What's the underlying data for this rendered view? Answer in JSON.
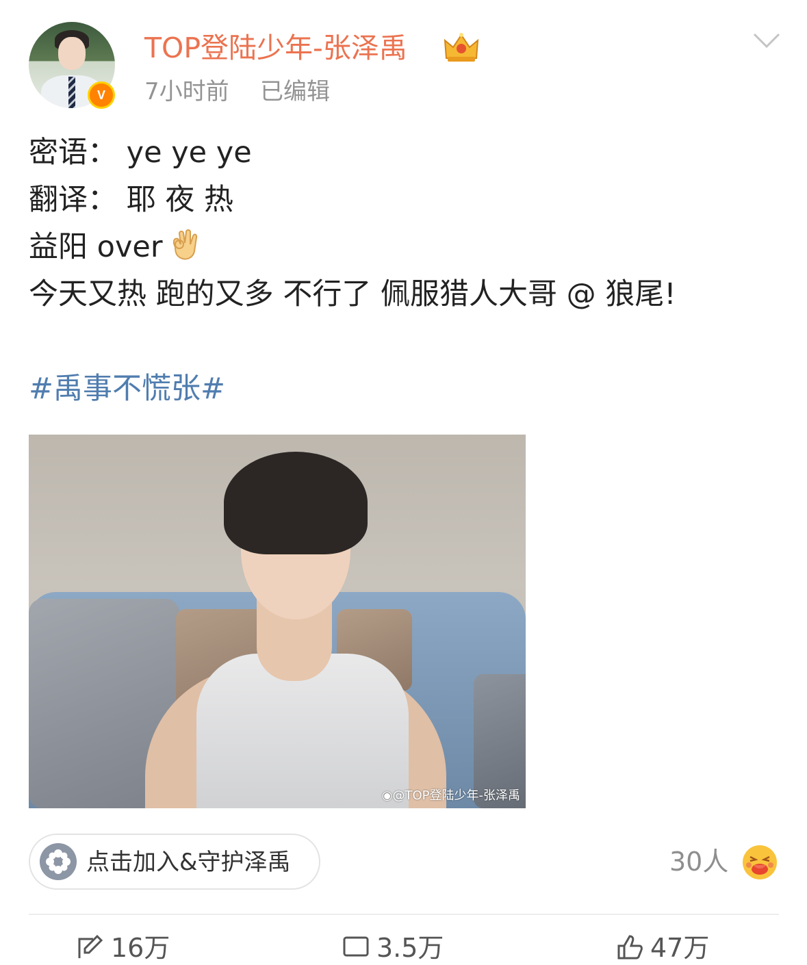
{
  "post": {
    "author": "TOP登陆少年-张泽禹",
    "verified_badge": "V",
    "time": "7小时前",
    "edited": "已编辑",
    "lines": [
      "密语：  ye ye ye",
      "翻译：  耶 夜 热",
      "益阳 over",
      "今天又热 跑的又多 不行了 佩服猎人大哥 @ 狼尾!"
    ],
    "topic": "#禹事不慌张#",
    "image_watermark": "@TOP登陆少年-张泽禹"
  },
  "fan_club": {
    "join_label": "点击加入&守护泽禹",
    "count": "30人"
  },
  "actions": {
    "repost": "16万",
    "comment": "3.5万",
    "like": "47万"
  },
  "colors": {
    "username": "#eb7350",
    "topic": "#507daf",
    "meta": "#939393",
    "badge": "#ff8200"
  },
  "icons": [
    "crown-icon",
    "chevron-down-icon",
    "ok-hand-icon",
    "flower-icon",
    "hot-face-emoji-icon",
    "repost-icon",
    "comment-icon",
    "like-icon"
  ]
}
